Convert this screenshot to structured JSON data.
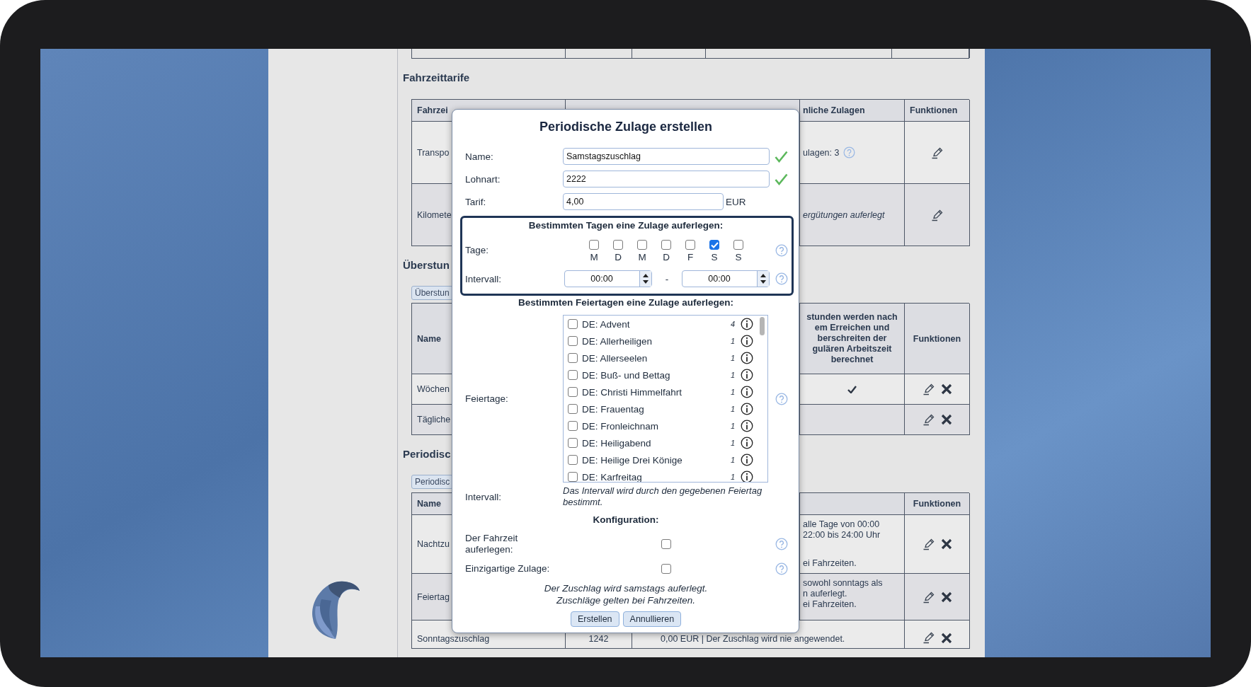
{
  "page": {
    "fare_section": {
      "title": "Fahrzeittarife",
      "columns": [
        "Fahrzei",
        "nliche Zulagen",
        "Funktionen"
      ],
      "rows": [
        {
          "name": "Transpo",
          "allowances": "ulagen: 3",
          "italic": false,
          "deletable": false
        },
        {
          "name": "Kilomete",
          "allowances": "ergütungen auferlegt",
          "italic": true,
          "deletable": false
        }
      ]
    },
    "overtime_section": {
      "title": "Überstun",
      "tab": "Überstun",
      "columns": [
        "Name",
        "Funktionen"
      ],
      "header_lines": [
        "stunden werden nach",
        "em Erreichen und",
        "berschreiten der",
        "gulären Arbeitszeit",
        "berechnet"
      ],
      "rows": [
        {
          "name": "Wöchen",
          "applies": true,
          "deletable": true
        },
        {
          "name": "Tägliche",
          "applies": false,
          "deletable": true
        }
      ]
    },
    "periodic_section": {
      "title": "Periodisc",
      "tab": "Periodisc",
      "columns": [
        "Name",
        "Funktionen"
      ],
      "rows": [
        {
          "name": "Nachtzu",
          "lines": [
            "alle Tage von 00:00",
            "22:00 bis 24:00 Uhr"
          ],
          "note": "ei Fahrzeiten.",
          "deletable": true
        },
        {
          "name": "Feiertag",
          "lines": [
            "sowohl sonntags als",
            "n auferlegt."
          ],
          "note": "ei Fahrzeiten.",
          "deletable": true
        }
      ],
      "last_row": {
        "name": "Sonntagszuschlag",
        "wage_type": "1242",
        "description": "0,00 EUR | Der Zuschlag wird nie angewendet.",
        "deletable": true
      }
    }
  },
  "dialog": {
    "title": "Periodische Zulage erstellen",
    "fields": [
      {
        "label": "Name:",
        "value": "Samstagszuschlag",
        "valid": true
      },
      {
        "label": "Lohnart:",
        "value": "2222",
        "valid": true
      },
      {
        "label": "Tarif:",
        "value": "4,00",
        "valid": false,
        "unit": "EUR"
      }
    ],
    "days_section": {
      "title": "Bestimmten Tagen eine Zulage auferlegen:",
      "label": "Tage:",
      "days": [
        {
          "letter": "M",
          "checked": false
        },
        {
          "letter": "D",
          "checked": false
        },
        {
          "letter": "M",
          "checked": false
        },
        {
          "letter": "D",
          "checked": false
        },
        {
          "letter": "F",
          "checked": false
        },
        {
          "letter": "S",
          "checked": true
        },
        {
          "letter": "S",
          "checked": false
        }
      ],
      "interval_label": "Intervall:",
      "from": "00:00",
      "separator": "-",
      "to": "00:00"
    },
    "holidays_section": {
      "title": "Bestimmten Feiertagen eine Zulage auferlegen:",
      "label": "Feiertage:",
      "holidays": [
        {
          "name": "DE: Advent",
          "count": "4",
          "checked": false
        },
        {
          "name": "DE: Allerheiligen",
          "count": "1",
          "checked": false
        },
        {
          "name": "DE: Allerseelen",
          "count": "1",
          "checked": false
        },
        {
          "name": "DE: Buß- und Bettag",
          "count": "1",
          "checked": false
        },
        {
          "name": "DE: Christi Himmelfahrt",
          "count": "1",
          "checked": false
        },
        {
          "name": "DE: Frauentag",
          "count": "1",
          "checked": false
        },
        {
          "name": "DE: Fronleichnam",
          "count": "1",
          "checked": false
        },
        {
          "name": "DE: Heiligabend",
          "count": "1",
          "checked": false
        },
        {
          "name": "DE: Heilige Drei Könige",
          "count": "1",
          "checked": false
        },
        {
          "name": "DE: Karfreitag",
          "count": "1",
          "checked": false
        }
      ],
      "interval_label": "Intervall:",
      "interval_note": "Das Intervall wird durch den gegebenen Feiertag bestimmt."
    },
    "config": {
      "title": "Konfiguration:",
      "options": [
        {
          "label": "Der Fahrzeit auferlegen:",
          "checked": false
        },
        {
          "label": "Einzigartige Zulage:",
          "checked": false
        }
      ]
    },
    "summary": [
      "Der Zuschlag wird samstags auferlegt.",
      "Zuschläge gelten bei Fahrzeiten."
    ],
    "buttons": [
      "Erstellen",
      "Annullieren"
    ]
  }
}
